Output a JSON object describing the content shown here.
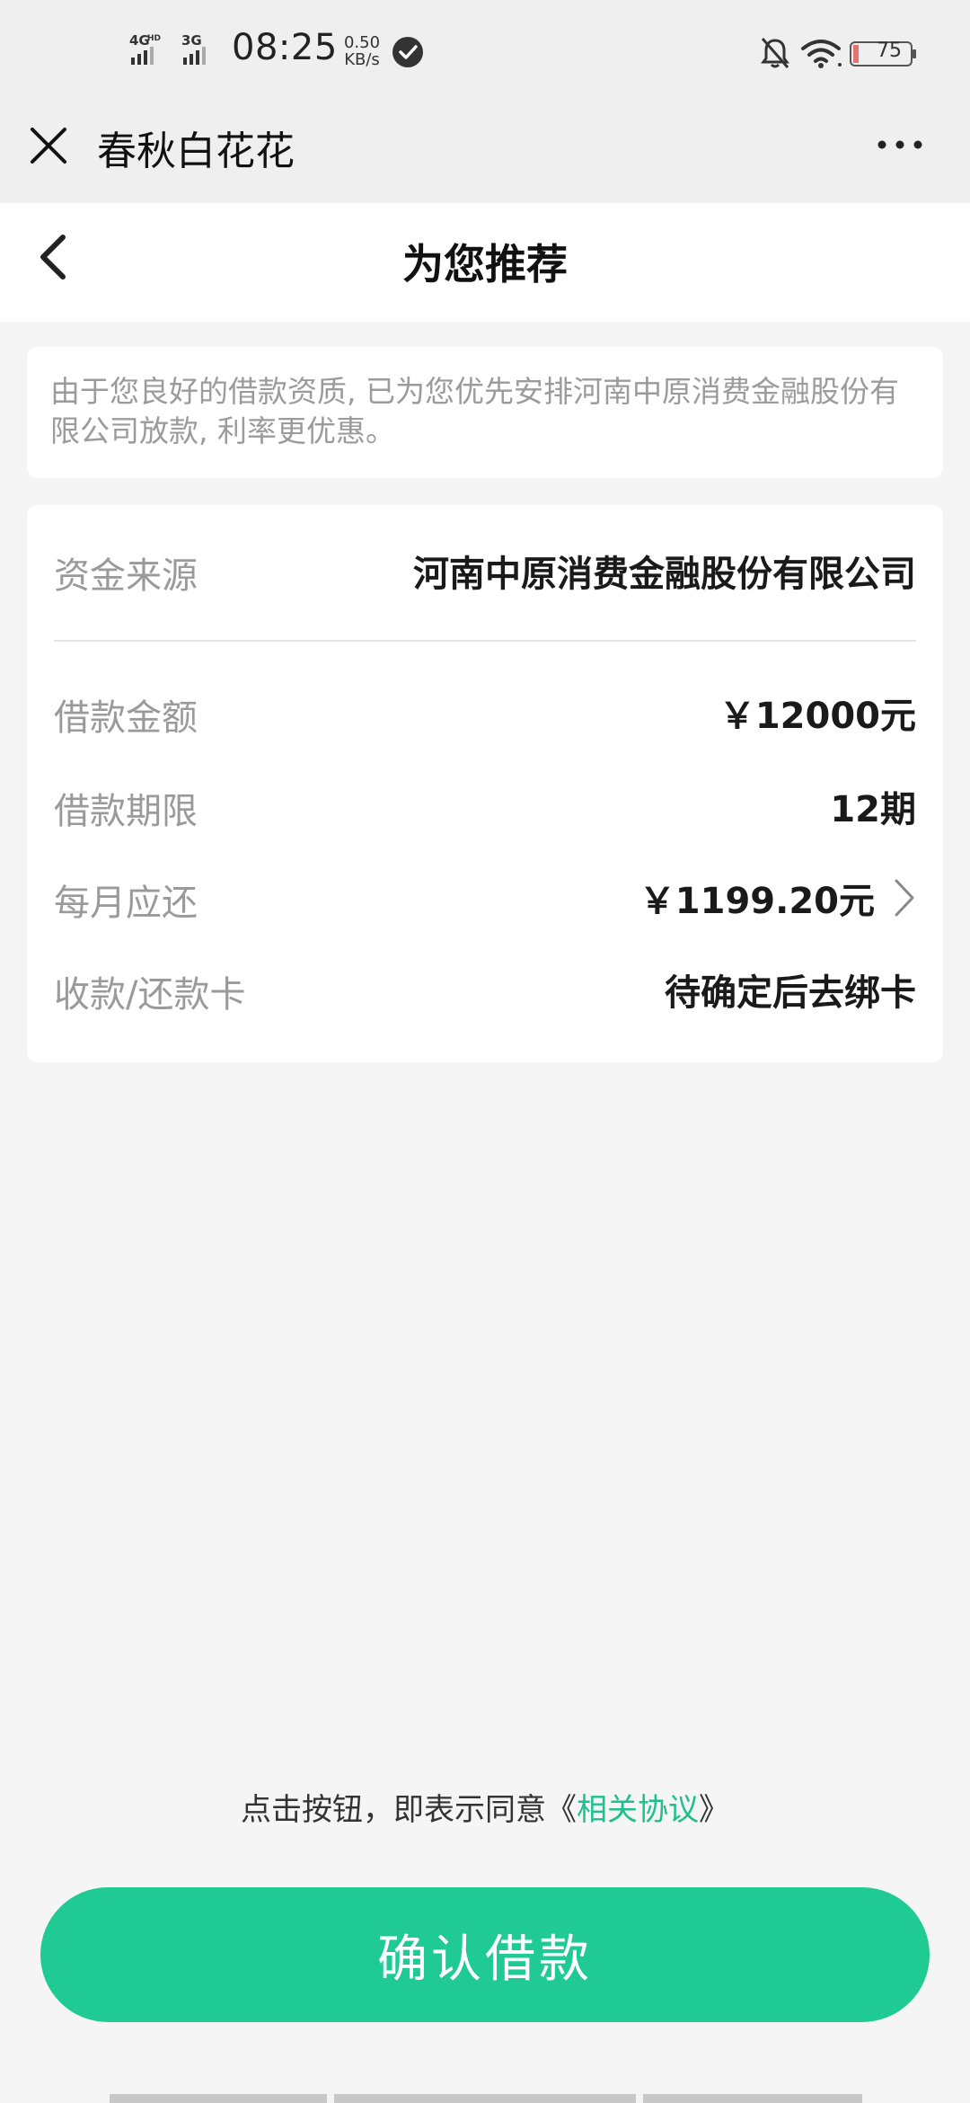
{
  "status_bar": {
    "network": "4GHD 3G",
    "time": "08:25",
    "speed_value": "0.50",
    "speed_unit": "KB/s",
    "battery": "75"
  },
  "app_header": {
    "title": "春秋白花花"
  },
  "nav": {
    "title": "为您推荐"
  },
  "notice": {
    "text": "由于您良好的借款资质, 已为您优先安排河南中原消费金融股份有限公司放款, 利率更优惠。"
  },
  "details": {
    "rows": [
      {
        "label": "资金来源",
        "value": "河南中原消费金融股份有限公司"
      },
      {
        "label": "借款金额",
        "value": "￥12000元"
      },
      {
        "label": "借款期限",
        "value": "12期"
      },
      {
        "label": "每月应还",
        "value": "￥1199.20元"
      },
      {
        "label": "收款/还款卡",
        "value": "待确定后去绑卡"
      }
    ]
  },
  "agreement": {
    "prefix": "点击按钮，即表示同意《",
    "link": "相关协议",
    "suffix": "》"
  },
  "confirm": {
    "label": "确认借款"
  },
  "colors": {
    "accent": "#1fcb92",
    "link": "#1fc08c",
    "background": "#f5f5f5"
  }
}
